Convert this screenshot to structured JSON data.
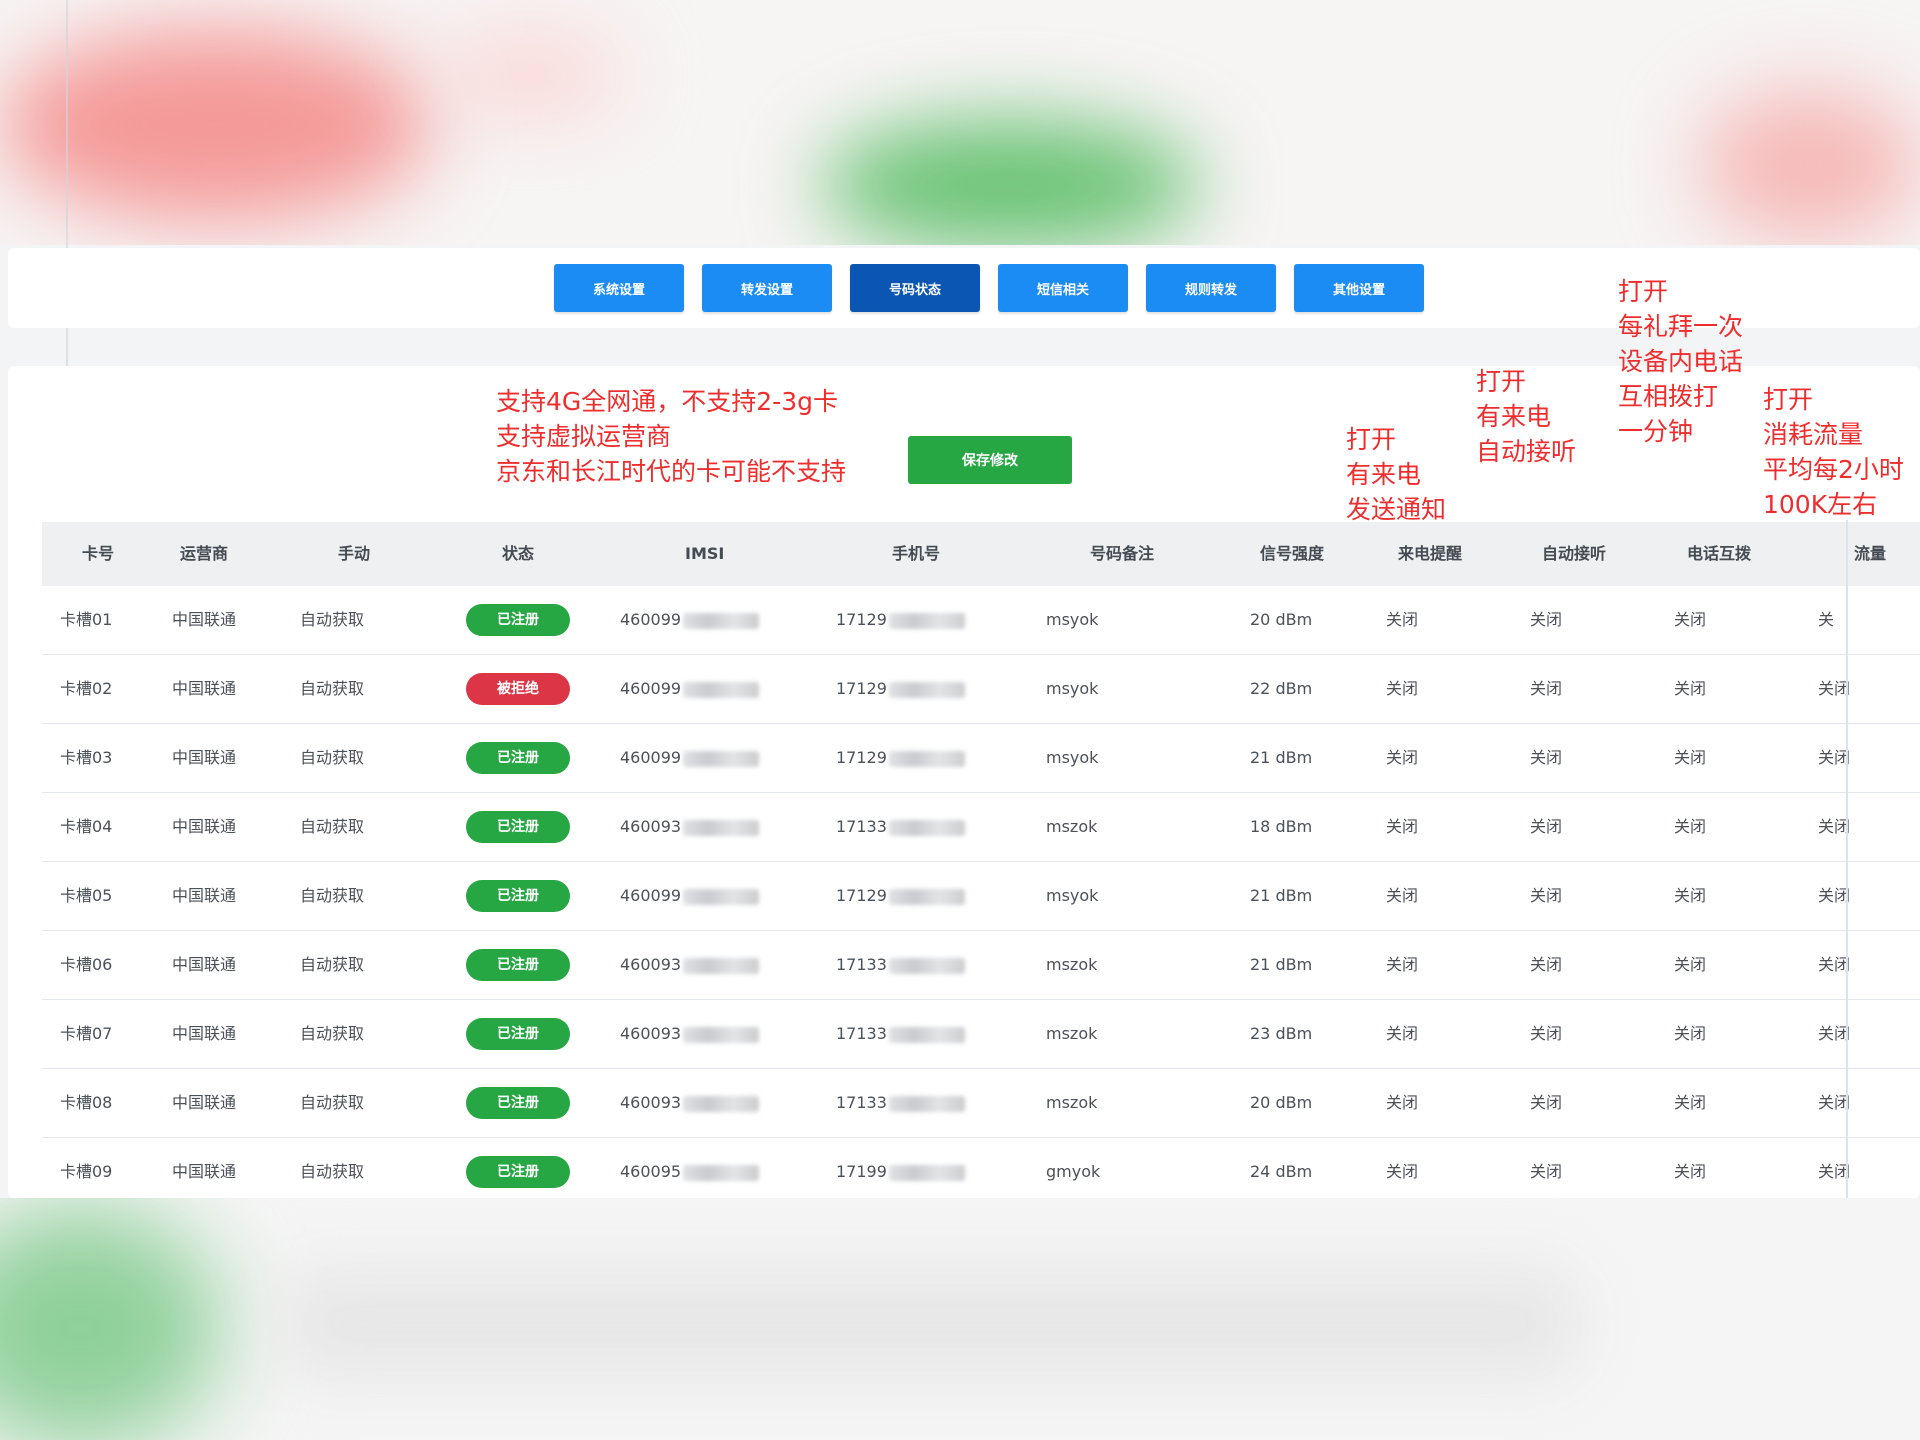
{
  "tabs": [
    {
      "label": "系统设置",
      "active": false
    },
    {
      "label": "转发设置",
      "active": false
    },
    {
      "label": "号码状态",
      "active": true
    },
    {
      "label": "短信相关",
      "active": false
    },
    {
      "label": "规则转发",
      "active": false
    },
    {
      "label": "其他设置",
      "active": false
    }
  ],
  "notes": {
    "network": "支持4G全网通，不支持2-3g卡\n支持虚拟运营商\n京东和长江时代的卡可能不支持",
    "incoming": "打开\n有来电\n发送通知",
    "auto_answer": "打开\n有来电\n自动接听",
    "mutual_call": "打开\n每礼拜一次\n设备内电话\n互相拨打\n一分钟",
    "data": "打开\n消耗流量\n平均每2小时\n100K左右"
  },
  "save_label": "保存修改",
  "colors": {
    "tab": "#1b8cf4",
    "tab_active": "#0b56b2",
    "save": "#27a743",
    "registered": "#27a743",
    "rejected": "#dc3545",
    "note": "#ee2e2e"
  },
  "columns": [
    "卡号",
    "运营商",
    "手动",
    "状态",
    "IMSI",
    "手机号",
    "号码备注",
    "信号强度",
    "来电提醒",
    "自动接听",
    "电话互拨",
    "流量"
  ],
  "rows": [
    {
      "slot": "卡槽01",
      "carrier": "中国联通",
      "manual": "自动获取",
      "status": "已注册",
      "imsi": "460099",
      "phone": "17129",
      "remark": "msyok",
      "signal": "20 dBm",
      "ring": "关闭",
      "answer": "关闭",
      "dial": "关闭",
      "traffic": "关"
    },
    {
      "slot": "卡槽02",
      "carrier": "中国联通",
      "manual": "自动获取",
      "status": "被拒绝",
      "imsi": "460099",
      "phone": "17129",
      "remark": "msyok",
      "signal": "22 dBm",
      "ring": "关闭",
      "answer": "关闭",
      "dial": "关闭",
      "traffic": "关闭"
    },
    {
      "slot": "卡槽03",
      "carrier": "中国联通",
      "manual": "自动获取",
      "status": "已注册",
      "imsi": "460099",
      "phone": "17129",
      "remark": "msyok",
      "signal": "21 dBm",
      "ring": "关闭",
      "answer": "关闭",
      "dial": "关闭",
      "traffic": "关闭"
    },
    {
      "slot": "卡槽04",
      "carrier": "中国联通",
      "manual": "自动获取",
      "status": "已注册",
      "imsi": "460093",
      "phone": "17133",
      "remark": "mszok",
      "signal": "18 dBm",
      "ring": "关闭",
      "answer": "关闭",
      "dial": "关闭",
      "traffic": "关闭"
    },
    {
      "slot": "卡槽05",
      "carrier": "中国联通",
      "manual": "自动获取",
      "status": "已注册",
      "imsi": "460099",
      "phone": "17129",
      "remark": "msyok",
      "signal": "21 dBm",
      "ring": "关闭",
      "answer": "关闭",
      "dial": "关闭",
      "traffic": "关闭"
    },
    {
      "slot": "卡槽06",
      "carrier": "中国联通",
      "manual": "自动获取",
      "status": "已注册",
      "imsi": "460093",
      "phone": "17133",
      "remark": "mszok",
      "signal": "21 dBm",
      "ring": "关闭",
      "answer": "关闭",
      "dial": "关闭",
      "traffic": "关闭"
    },
    {
      "slot": "卡槽07",
      "carrier": "中国联通",
      "manual": "自动获取",
      "status": "已注册",
      "imsi": "460093",
      "phone": "17133",
      "remark": "mszok",
      "signal": "23 dBm",
      "ring": "关闭",
      "answer": "关闭",
      "dial": "关闭",
      "traffic": "关闭"
    },
    {
      "slot": "卡槽08",
      "carrier": "中国联通",
      "manual": "自动获取",
      "status": "已注册",
      "imsi": "460093",
      "phone": "17133",
      "remark": "mszok",
      "signal": "20 dBm",
      "ring": "关闭",
      "answer": "关闭",
      "dial": "关闭",
      "traffic": "关闭"
    },
    {
      "slot": "卡槽09",
      "carrier": "中国联通",
      "manual": "自动获取",
      "status": "已注册",
      "imsi": "460095",
      "phone": "17199",
      "remark": "gmyok",
      "signal": "24 dBm",
      "ring": "关闭",
      "answer": "关闭",
      "dial": "关闭",
      "traffic": "关闭"
    }
  ]
}
